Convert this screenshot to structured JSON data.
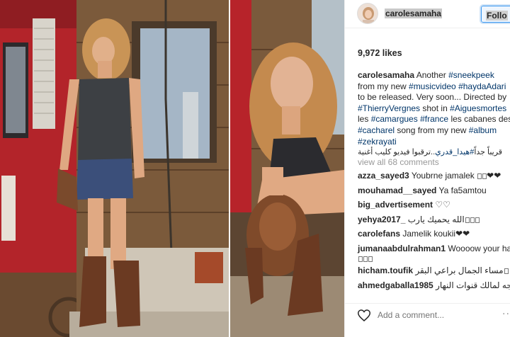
{
  "post": {
    "username": "carolesamaha",
    "follow_label": "Follo",
    "likes": "9,972 likes",
    "caption": {
      "user": "carolesamaha",
      "lines": [
        [
          {
            "t": "text",
            "v": " Another "
          },
          {
            "t": "tag",
            "v": "#sneekpeek"
          }
        ],
        [
          {
            "t": "text",
            "v": "from my new "
          },
          {
            "t": "tag",
            "v": "#musicvideo"
          },
          {
            "t": "text",
            "v": " "
          },
          {
            "t": "tag",
            "v": "#haydaAdari"
          }
        ],
        [
          {
            "t": "text",
            "v": "to be released. Very soon... Directed by"
          }
        ],
        [
          {
            "t": "tag",
            "v": "#ThierryVergnes"
          },
          {
            "t": "text",
            "v": " shot in "
          },
          {
            "t": "tag",
            "v": "#Aiguesmortes"
          }
        ],
        [
          {
            "t": "text",
            "v": "les "
          },
          {
            "t": "tag",
            "v": "#camargues"
          },
          {
            "t": "text",
            "v": " "
          },
          {
            "t": "tag",
            "v": "#france"
          },
          {
            "t": "text",
            "v": " les cabanes des"
          }
        ],
        [
          {
            "t": "tag",
            "v": "#cacharel"
          },
          {
            "t": "text",
            "v": " song from my new "
          },
          {
            "t": "tag",
            "v": "#album"
          }
        ],
        [
          {
            "t": "tag",
            "v": "#zekrayati"
          }
        ],
        [
          {
            "t": "text",
            "v": "..ترقبوا فيديو كليب أغنية"
          },
          {
            "t": "tag",
            "v": "#هيدا_قدري"
          },
          {
            "t": "text",
            "v": " قريباً جداً"
          }
        ]
      ]
    },
    "view_all": "view all 68 comments",
    "comments": [
      {
        "user": "azza_sayed3",
        "text": "Youbrne jamalek ",
        "tail": "❤❤"
      },
      {
        "user": "mouhamad__sayed",
        "text": "Ya fa5amtou",
        "tail": ""
      },
      {
        "user": "big_advertisement",
        "text": "♡♡",
        "tail": ""
      },
      {
        "user": "yehya2017_",
        "text": "الله يحميك يارب",
        "tail": ""
      },
      {
        "user": "carolefans",
        "text": "Jamelik koukii",
        "tail": "❤❤"
      },
      {
        "user": "jumanaabdulrahman1",
        "text": "Woooow your hair",
        "tail": ""
      },
      {
        "user": "hicham.toufik",
        "text": "مساء الجمال براعي البقر",
        "tail": ""
      },
      {
        "user": "ahmedgaballa1985",
        "text": "أموزوجه لمالك قنوات النهار",
        "tail": ""
      }
    ],
    "add_comment_placeholder": "Add a comment...",
    "more_label": "..."
  }
}
